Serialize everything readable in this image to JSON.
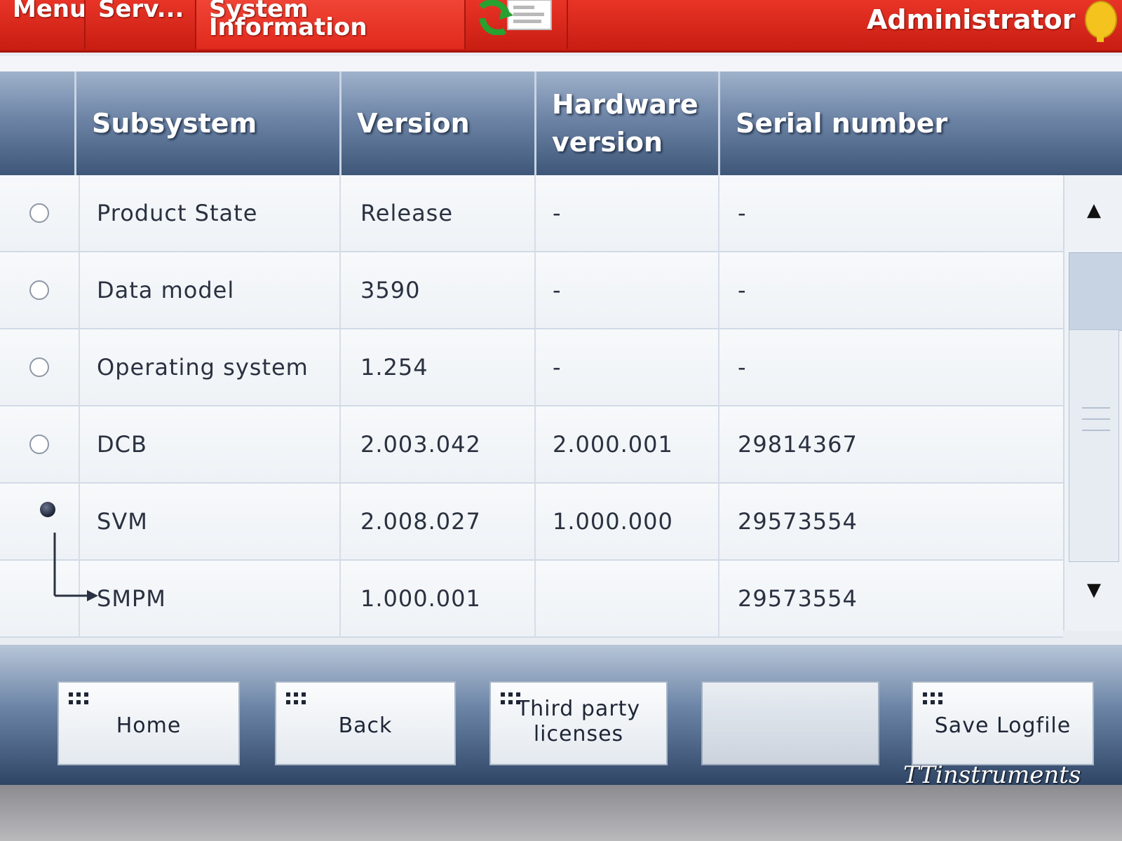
{
  "topbar": {
    "tabs": [
      {
        "label": "Menu"
      },
      {
        "label": "Serv..."
      },
      {
        "label": "System Information"
      }
    ],
    "export_icon": "export-log-icon",
    "user": "Administrator",
    "key_icon": "key-icon"
  },
  "table": {
    "columns": [
      "Subsystem",
      "Version",
      "Hardware version",
      "Serial number"
    ],
    "rows": [
      {
        "subsystem": "Product State",
        "version": "Release",
        "hardware_version": "-",
        "serial_number": "-",
        "selected": false
      },
      {
        "subsystem": "Data model",
        "version": "3590",
        "hardware_version": "-",
        "serial_number": "-",
        "selected": false
      },
      {
        "subsystem": "Operating system",
        "version": "1.254",
        "hardware_version": "-",
        "serial_number": "-",
        "selected": false
      },
      {
        "subsystem": "DCB",
        "version": "2.003.042",
        "hardware_version": "2.000.001",
        "serial_number": "29814367",
        "selected": false
      },
      {
        "subsystem": "SVM",
        "version": "2.008.027",
        "hardware_version": "1.000.000",
        "serial_number": "29573554",
        "selected": true
      },
      {
        "subsystem": "SMPM",
        "version": "1.000.001",
        "hardware_version": "",
        "serial_number": "29573554",
        "selected": false
      }
    ]
  },
  "scrollbar": {
    "up_icon": "scroll-up-arrow-icon",
    "down_icon": "scroll-down-arrow-icon"
  },
  "buttons": {
    "home": "Home",
    "back": "Back",
    "third_party_line1": "Third party",
    "third_party_line2": "licenses",
    "empty": "",
    "save_logfile": "Save Logfile"
  },
  "watermark": "TTinstruments",
  "colors": {
    "topbar_red": "#d8261a",
    "header_blue": "#5b7396",
    "row_bg": "#f3f6f9",
    "text_dark": "#2a3140"
  }
}
